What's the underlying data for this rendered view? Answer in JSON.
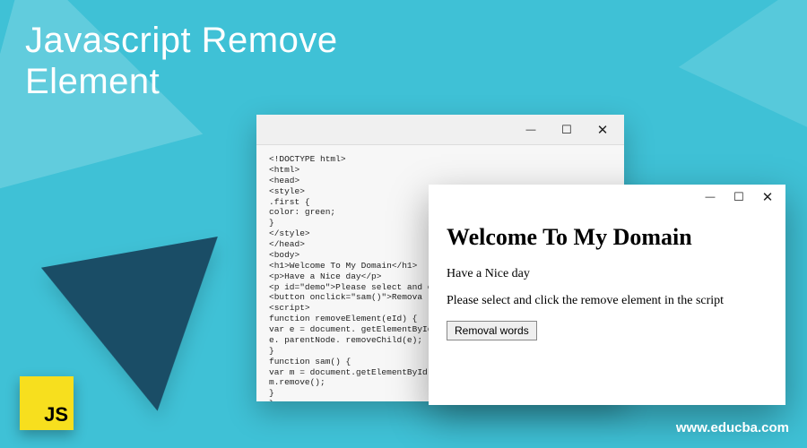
{
  "page_title": "Javascript Remove\nElement",
  "code_window": {
    "code": "<!DOCTYPE html>\n<html>\n<head>\n<style>\n.first {\ncolor: green;\n}\n</style>\n</head>\n<body>\n<h1>Welcome To My Domain</h1>\n<p>Have a Nice day</p>\n<p id=\"demo\">Please select and c\n<button onclick=\"sam()\">Remova\n<script>\nfunction removeElement(eId) {\nvar e = document. getElementById\ne. parentNode. removeChild(e);\n}\nfunction sam() {\nvar m = document.getElementById\nm.remove();\n}\n}\n</script>\n</body>\n</html>"
  },
  "result_window": {
    "heading": "Welcome To My Domain",
    "para1": "Have a Nice day",
    "para2": "Please select and click the remove element in the script",
    "button": "Removal words"
  },
  "logo_text": "JS",
  "site_url": "www.educba.com"
}
